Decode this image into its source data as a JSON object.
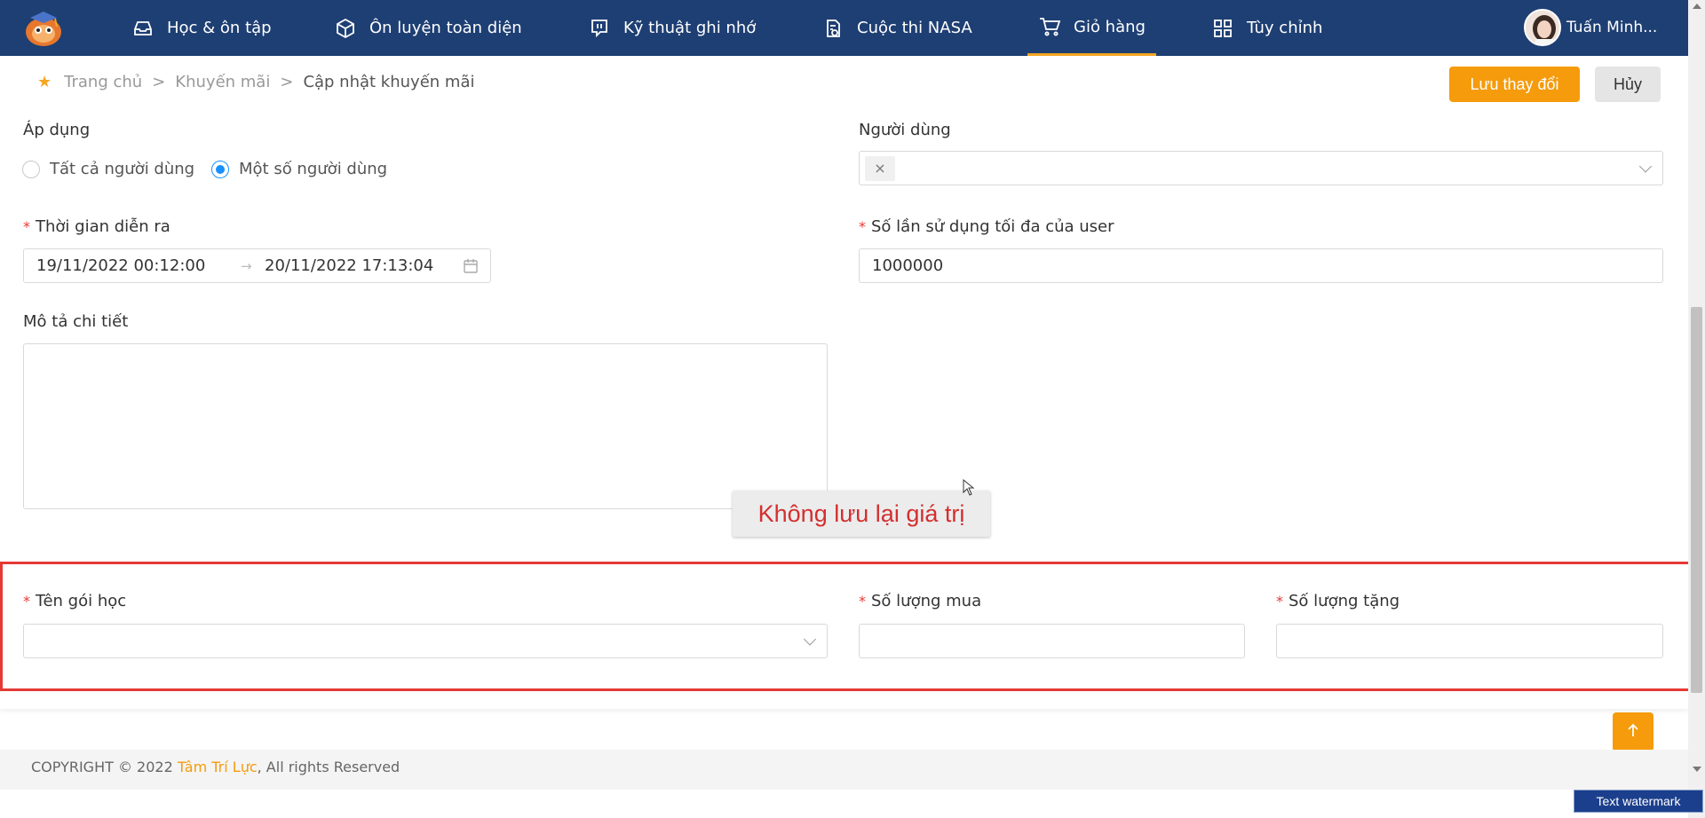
{
  "nav": {
    "items": [
      {
        "label": "Học & ôn tập",
        "icon": "inbox-icon"
      },
      {
        "label": "Ôn luyện toàn diện",
        "icon": "box-icon"
      },
      {
        "label": "Kỹ thuật ghi nhớ",
        "icon": "chat-icon"
      },
      {
        "label": "Cuộc thi NASA",
        "icon": "clipboard-icon"
      },
      {
        "label": "Giỏ hàng",
        "icon": "cart-icon",
        "active": true
      },
      {
        "label": "Tùy chỉnh",
        "icon": "grid-icon"
      }
    ],
    "user_name": "Tuấn Minh..."
  },
  "breadcrumb": {
    "home": "Trang chủ",
    "section": "Khuyến mãi",
    "current": "Cập nhật khuyến mãi",
    "separator": ">"
  },
  "actions": {
    "save_label": "Lưu thay đổi",
    "cancel_label": "Hủy"
  },
  "form": {
    "apply_label": "Áp dụng",
    "apply_options": [
      "Tất cả người dùng",
      "Một số người dùng"
    ],
    "apply_selected": "Một số người dùng",
    "users_label": "Người dùng",
    "users_tag_remove": "×",
    "time_label": "Thời gian diễn ra",
    "time_start": "19/11/2022 00:12:00",
    "time_end": "20/11/2022 17:13:04",
    "time_separator": "→",
    "max_use_label": "Số lần sử dụng tối đa của user",
    "max_use_value": "1000000",
    "description_label": "Mô tả chi tiết",
    "description_value": "",
    "package_label": "Tên gói học",
    "package_value": "",
    "buy_qty_label": "Số lượng mua",
    "buy_qty_value": "",
    "gift_qty_label": "Số lượng tặng",
    "gift_qty_value": "",
    "required_mark": "*"
  },
  "annotation": {
    "text": "Không lưu lại giá trị",
    "color": "#d32f2f"
  },
  "footer": {
    "prefix": "COPYRIGHT © 2022 ",
    "brand": "Tâm Trí Lực",
    "suffix": ", All rights Reserved"
  },
  "watermark": "Text watermark",
  "colors": {
    "nav_bg": "#1e3f73",
    "accent": "#f59b0c",
    "radio_active": "#1890ff",
    "highlight_border": "#e53935"
  }
}
